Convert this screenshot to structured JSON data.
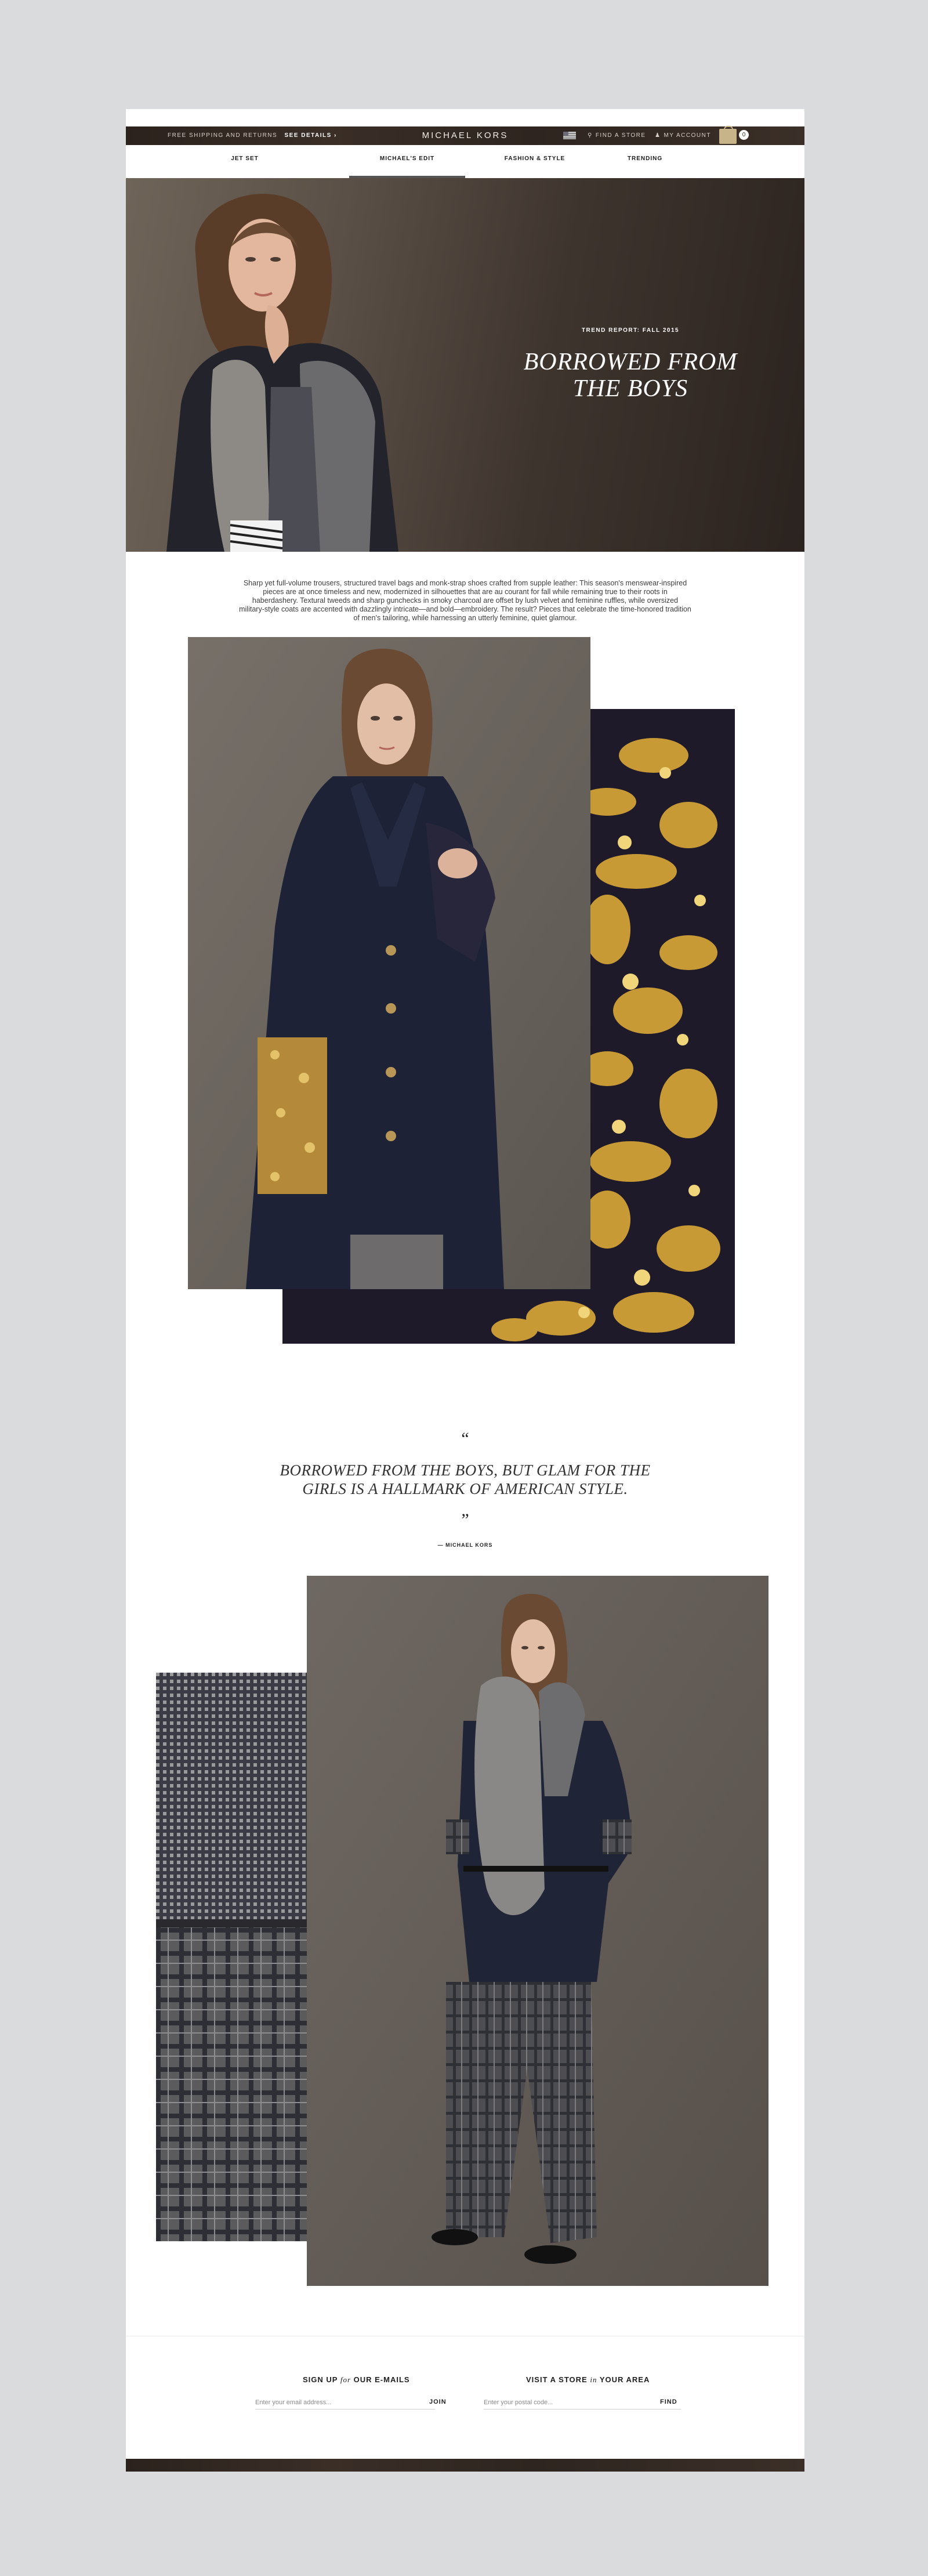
{
  "topbar": {
    "shipping_text": "FREE SHIPPING AND RETURNS",
    "see_details": "SEE DETAILS ›",
    "brand": "MICHAEL KORS",
    "find_store": "FIND A STORE",
    "my_account": "MY ACCOUNT",
    "bag_count": "0"
  },
  "nav": {
    "tabs": [
      {
        "label": "JET SET"
      },
      {
        "label": "MICHAEL'S EDIT"
      },
      {
        "label": "FASHION & STYLE"
      },
      {
        "label": "TRENDING"
      }
    ],
    "active": "MICHAEL'S EDIT"
  },
  "hero": {
    "kicker": "TREND REPORT: FALL 2015",
    "title_line1": "BORROWED FROM",
    "title_line2": "THE BOYS"
  },
  "intro": "Sharp yet full-volume trousers, structured travel bags and monk-strap shoes crafted from supple leather: This season's menswear-inspired pieces are at once timeless and new, modernized in silhouettes that are au courant for fall while remaining true to their roots in haberdashery. Textural tweeds and sharp gunchecks in smoky charcoal are offset by lush velvet and feminine ruffles, while oversized military-style coats are accented with dazzlingly intricate—and bold—embroidery. The result? Pieces that celebrate the time-honored tradition of men's tailoring, while harnessing an utterly feminine, quiet glamour.",
  "quote": {
    "open_mark": "“",
    "line1": "BORROWED FROM THE BOYS, BUT GLAM FOR THE",
    "line2": "GIRLS IS A HALLMARK OF AMERICAN STYLE.",
    "close_mark": "”",
    "attribution": "— MICHAEL KORS"
  },
  "footer": {
    "signup_pre": "SIGN UP",
    "signup_for": "for",
    "signup_post": "OUR E-MAILS",
    "email_placeholder": "Enter your email address...",
    "join_label": "JOIN",
    "visit_pre": "VISIT A STORE",
    "visit_in": "in",
    "visit_post": "YOUR AREA",
    "postal_placeholder": "Enter your postal code...",
    "find_label": "FIND"
  },
  "colors": {
    "brand_bar": "#2e2520",
    "bag_gold": "#c8b489",
    "page_bg": "#dadbdd"
  },
  "icons": [
    "flag-icon",
    "location-pin-icon",
    "user-icon",
    "shopping-bag-icon"
  ]
}
